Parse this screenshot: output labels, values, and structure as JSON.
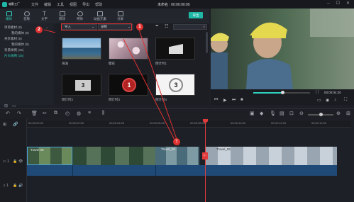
{
  "app": {
    "logo_text": "喵影工厂",
    "menu": [
      "文件",
      "编辑",
      "工具",
      "视图",
      "导出",
      "帮助"
    ],
    "project_title": "未命名 : 00:00:00:00"
  },
  "tabs": [
    {
      "label": "媒体",
      "icon": "folder-icon",
      "active": true
    },
    {
      "label": "音频",
      "icon": "music-icon",
      "active": false
    },
    {
      "label": "文字",
      "icon": "text-icon",
      "active": false
    },
    {
      "label": "转场",
      "icon": "transition-icon",
      "active": false
    },
    {
      "label": "特效",
      "icon": "effects-icon",
      "active": false
    },
    {
      "label": "动画元素",
      "icon": "elements-icon",
      "active": false
    },
    {
      "label": "分屏",
      "icon": "split-screen-icon",
      "active": false
    }
  ],
  "export_label": "导出",
  "sidebar": {
    "items": [
      {
        "label": "项目素材 (0)",
        "indent": false,
        "active": false
      },
      {
        "label": "我的媒体 (0)",
        "indent": true,
        "active": false
      },
      {
        "label": "共享素材 (0)",
        "indent": false,
        "active": false
      },
      {
        "label": "我的媒体 (0)",
        "indent": true,
        "active": false
      },
      {
        "label": "背景样例 (15)",
        "indent": false,
        "active": false
      },
      {
        "label": "片头样例 (15)",
        "indent": false,
        "active": true
      }
    ]
  },
  "media": {
    "import_label": "导入",
    "record_label": "录制",
    "items": [
      {
        "label": "海滩",
        "kind": "beach"
      },
      {
        "label": "樱花",
        "kind": "blossom"
      },
      {
        "label": "倒计时1",
        "kind": "clapper"
      },
      {
        "label": "倒计时2",
        "kind": "countdown3"
      },
      {
        "label": "倒计时3",
        "kind": "countdown1"
      },
      {
        "label": "倒计时4",
        "kind": "countdown3w"
      }
    ]
  },
  "player": {
    "timecode": "00:00:04:20"
  },
  "timeline": {
    "ruler_ticks": [
      "00:00:00:00",
      "00:00:02:00",
      "00:00:04:00",
      "00:00:06:00",
      "00:00:08:00",
      "00:00:10:00",
      "00:00:12:00",
      "00:00:14:00"
    ],
    "clip_labels": [
      "Travel 06",
      "Travel_06",
      "Travel_06"
    ],
    "track_video_label": "1",
    "track_audio_label": "1"
  },
  "annotations": [
    "1",
    "2",
    "3"
  ],
  "colors": {
    "accent": "#1fb7a6",
    "playhead": "#e23b3b",
    "annotation": "#e03131",
    "clip_audio": "#1f4a78"
  }
}
